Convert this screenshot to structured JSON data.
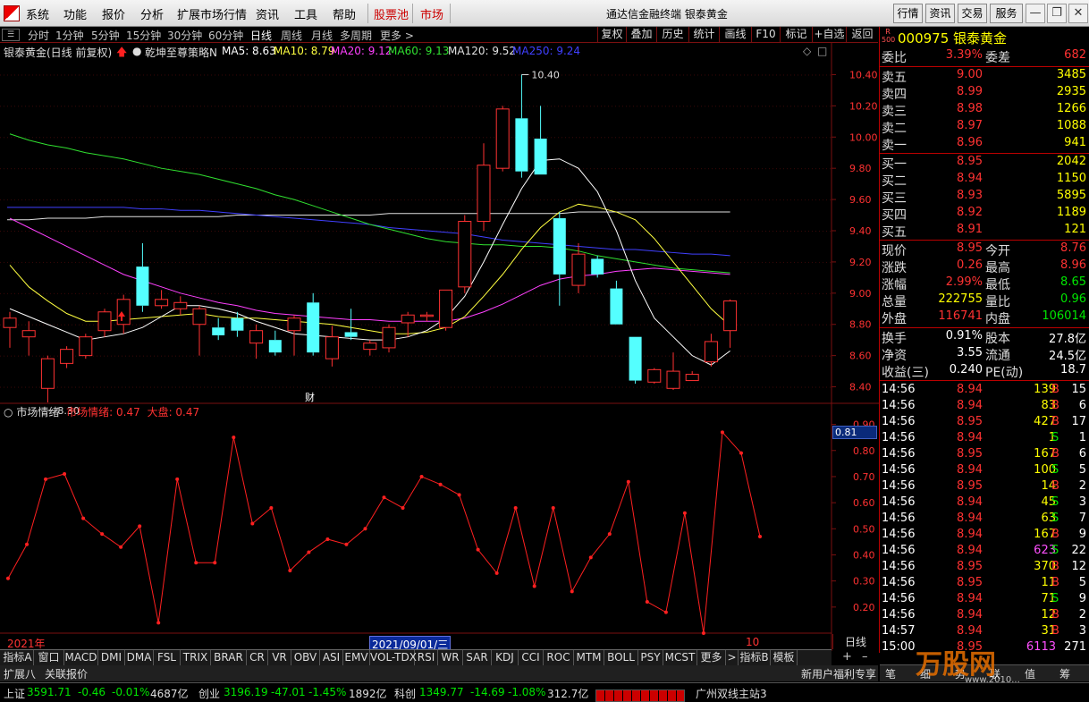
{
  "menu": {
    "items": [
      "系统",
      "功能",
      "报价",
      "分析",
      "扩展市场行情",
      "资讯",
      "工具",
      "帮助"
    ],
    "stock_pool": "股票池",
    "market": "市场",
    "title": "通达信金融终端 银泰黄金",
    "right_buttons": [
      "行情",
      "资讯",
      "交易",
      "服务"
    ]
  },
  "period_bar": {
    "periods": [
      "分时",
      "1分钟",
      "5分钟",
      "15分钟",
      "30分钟",
      "60分钟",
      "日线",
      "周线",
      "月线",
      "多周期",
      "更多 >"
    ],
    "active": "日线",
    "tools": [
      "复权",
      "叠加",
      "历史",
      "统计",
      "画线",
      "F10",
      "标记",
      "+自选",
      "返回"
    ]
  },
  "ma_bar": {
    "name": "银泰黄金(日线 前复权)",
    "strategy": "乾坤至尊策略N",
    "items": [
      {
        "label": "MA5: 8.63",
        "color": "#ffffff"
      },
      {
        "label": "MA10: 8.79",
        "color": "#ffff40"
      },
      {
        "label": "MA20: 9.12",
        "color": "#ff40ff"
      },
      {
        "label": "MA60: 9.13",
        "color": "#30e030"
      },
      {
        "label": "MA120: 9.52",
        "color": "#e0e0e0"
      },
      {
        "label": "MA250: 9.24",
        "color": "#4040ff"
      }
    ]
  },
  "indicator": {
    "name": "市场情绪",
    "value_label": "市场情绪: 0.47",
    "market_label": "大盘: 0.47",
    "current": "0.81"
  },
  "colors": {
    "up": "#ff3232",
    "down": "#54ffff",
    "grid": "#7a1010"
  },
  "chart_data": [
    {
      "type": "candlestick",
      "title": "银泰黄金(日线 前复权)",
      "ylim": [
        8.3,
        10.5
      ],
      "y_ticks": [
        "10.40",
        "10.20",
        "10.00",
        "9.80",
        "9.60",
        "9.40",
        "9.20",
        "9.00",
        "8.80",
        "8.60",
        "8.40"
      ],
      "high_label": "10.40",
      "low_label": "8.30",
      "event_label": "财",
      "ohlc": [
        [
          8.78,
          8.84,
          8.65,
          8.88
        ],
        [
          8.72,
          8.76,
          8.6,
          8.82
        ],
        [
          8.39,
          8.58,
          8.3,
          8.6
        ],
        [
          8.55,
          8.64,
          8.52,
          8.66
        ],
        [
          8.6,
          8.72,
          8.58,
          8.74
        ],
        [
          8.76,
          8.88,
          8.72,
          8.9
        ],
        [
          8.8,
          8.96,
          8.74,
          8.99
        ],
        [
          9.17,
          8.92,
          8.88,
          9.32
        ],
        [
          8.92,
          8.96,
          8.9,
          9.02
        ],
        [
          8.9,
          8.94,
          8.86,
          8.98
        ],
        [
          8.8,
          8.9,
          8.6,
          8.92
        ],
        [
          8.78,
          8.73,
          8.7,
          8.84
        ],
        [
          8.84,
          8.76,
          8.72,
          8.88
        ],
        [
          8.68,
          8.76,
          8.58,
          8.8
        ],
        [
          8.7,
          8.62,
          8.6,
          8.76
        ],
        [
          8.76,
          8.84,
          8.6,
          8.86
        ],
        [
          8.94,
          8.62,
          8.6,
          9.0
        ],
        [
          8.58,
          8.72,
          8.53,
          8.79
        ],
        [
          8.75,
          8.72,
          8.7,
          8.9
        ],
        [
          8.64,
          8.68,
          8.6,
          8.7
        ],
        [
          8.65,
          8.78,
          8.62,
          8.8
        ],
        [
          8.81,
          8.86,
          8.72,
          8.88
        ],
        [
          8.86,
          8.86,
          8.82,
          8.88
        ],
        [
          8.78,
          9.02,
          8.76,
          9.02
        ],
        [
          9.04,
          9.46,
          9.0,
          9.5
        ],
        [
          9.46,
          9.82,
          9.4,
          9.96
        ],
        [
          9.8,
          10.18,
          9.78,
          10.2
        ],
        [
          10.12,
          9.78,
          9.74,
          10.4
        ],
        [
          9.99,
          9.76,
          9.76,
          10.2
        ],
        [
          9.48,
          9.12,
          8.92,
          9.52
        ],
        [
          9.05,
          9.25,
          9.0,
          9.32
        ],
        [
          9.22,
          9.12,
          9.1,
          9.24
        ],
        [
          9.03,
          8.8,
          8.8,
          9.08
        ],
        [
          8.72,
          8.44,
          8.42,
          8.72
        ],
        [
          8.43,
          8.51,
          8.42,
          8.52
        ],
        [
          8.39,
          8.5,
          8.38,
          8.62
        ],
        [
          8.44,
          8.48,
          8.44,
          8.5
        ],
        [
          8.56,
          8.69,
          8.53,
          8.74
        ],
        [
          8.76,
          8.95,
          8.65,
          8.96
        ]
      ],
      "series": [
        {
          "name": "MA5",
          "values": [
            8.9,
            8.85,
            8.8,
            8.75,
            8.7,
            8.72,
            8.74,
            8.78,
            8.85,
            8.92,
            8.92,
            8.9,
            8.87,
            8.82,
            8.78,
            8.74,
            8.73,
            8.72,
            8.71,
            8.7,
            8.7,
            8.72,
            8.76,
            8.84,
            8.98,
            9.2,
            9.44,
            9.67,
            9.85,
            9.86,
            9.8,
            9.65,
            9.4,
            9.08,
            8.84,
            8.72,
            8.6,
            8.54,
            8.63
          ]
        },
        {
          "name": "MA10",
          "values": [
            9.18,
            9.04,
            8.95,
            8.87,
            8.82,
            8.82,
            8.83,
            8.84,
            8.85,
            8.86,
            8.87,
            8.85,
            8.84,
            8.84,
            8.83,
            8.82,
            8.81,
            8.8,
            8.78,
            8.76,
            8.74,
            8.74,
            8.75,
            8.78,
            8.85,
            8.98,
            9.12,
            9.28,
            9.42,
            9.52,
            9.57,
            9.55,
            9.52,
            9.47,
            9.35,
            9.2,
            9.05,
            8.9,
            8.79
          ]
        },
        {
          "name": "MA20",
          "values": [
            9.48,
            9.42,
            9.36,
            9.3,
            9.24,
            9.18,
            9.12,
            9.08,
            9.04,
            9.0,
            8.97,
            8.94,
            8.92,
            8.89,
            8.87,
            8.86,
            8.85,
            8.84,
            8.83,
            8.83,
            8.82,
            8.82,
            8.82,
            8.82,
            8.84,
            8.88,
            8.93,
            8.99,
            9.05,
            9.09,
            9.11,
            9.12,
            9.14,
            9.15,
            9.16,
            9.15,
            9.14,
            9.13,
            9.12
          ]
        },
        {
          "name": "MA60",
          "values": [
            10.02,
            9.98,
            9.95,
            9.93,
            9.9,
            9.88,
            9.86,
            9.83,
            9.8,
            9.78,
            9.76,
            9.73,
            9.7,
            9.67,
            9.63,
            9.6,
            9.56,
            9.52,
            9.48,
            9.44,
            9.41,
            9.38,
            9.35,
            9.33,
            9.32,
            9.31,
            9.31,
            9.3,
            9.3,
            9.29,
            9.27,
            9.24,
            9.22,
            9.2,
            9.18,
            9.16,
            9.15,
            9.14,
            9.13
          ]
        },
        {
          "name": "MA120",
          "values": [
            9.47,
            9.47,
            9.48,
            9.48,
            9.48,
            9.49,
            9.49,
            9.49,
            9.49,
            9.49,
            9.49,
            9.49,
            9.5,
            9.5,
            9.5,
            9.5,
            9.5,
            9.5,
            9.5,
            9.5,
            9.51,
            9.51,
            9.51,
            9.51,
            9.51,
            9.51,
            9.51,
            9.51,
            9.51,
            9.51,
            9.52,
            9.52,
            9.52,
            9.52,
            9.52,
            9.52,
            9.52,
            9.52,
            9.52
          ]
        },
        {
          "name": "MA250",
          "values": [
            9.55,
            9.55,
            9.55,
            9.55,
            9.55,
            9.55,
            9.55,
            9.54,
            9.54,
            9.53,
            9.53,
            9.52,
            9.51,
            9.5,
            9.49,
            9.48,
            9.47,
            9.46,
            9.45,
            9.44,
            9.42,
            9.41,
            9.4,
            9.39,
            9.38,
            9.36,
            9.34,
            9.33,
            9.32,
            9.31,
            9.3,
            9.29,
            9.28,
            9.28,
            9.27,
            9.26,
            9.25,
            9.25,
            9.24
          ]
        }
      ]
    },
    {
      "type": "line",
      "title": "市场情绪",
      "ylim": [
        0.1,
        0.95
      ],
      "y_ticks": [
        "0.90",
        "0.80",
        "0.70",
        "0.60",
        "0.50",
        "0.40",
        "0.30",
        "0.20"
      ],
      "series": [
        {
          "name": "市场情绪",
          "values": [
            0.31,
            0.44,
            0.69,
            0.71,
            0.54,
            0.48,
            0.43,
            0.51,
            0.14,
            0.69,
            0.37,
            0.37,
            0.85,
            0.52,
            0.58,
            0.34,
            0.41,
            0.46,
            0.44,
            0.5,
            0.62,
            0.58,
            0.7,
            0.67,
            0.63,
            0.42,
            0.33,
            0.58,
            0.28,
            0.58,
            0.26,
            0.39,
            0.48,
            0.68,
            0.22,
            0.18,
            0.56,
            0.1,
            0.87,
            0.79,
            0.47
          ]
        }
      ]
    }
  ],
  "x_axis": {
    "year": "2021年",
    "cursor_date": "2021/09/01/三",
    "end_label": "10",
    "period": "日线"
  },
  "indicator_tabs": [
    "指标A",
    "窗口",
    "MACD",
    "DMI",
    "DMA",
    "FSL",
    "TRIX",
    "BRAR",
    "CR",
    "VR",
    "OBV",
    "ASI",
    "EMV",
    "VOL-TDX",
    "RSI",
    "WR",
    "SAR",
    "KDJ",
    "CCI",
    "ROC",
    "MTM",
    "BOLL",
    "PSY",
    "MCST",
    "更多",
    ">",
    "指标B",
    "模板"
  ],
  "ext_tabs": [
    "扩展八",
    "关联报价"
  ],
  "welfare": "新用户福利专享",
  "quote": {
    "badge_top": "R",
    "badge_bottom": "500",
    "code_name": "000975 银泰黄金",
    "weibi": {
      "l": "委比",
      "v": "3.39%",
      "l2": "委差",
      "v2": "682"
    },
    "sell": [
      {
        "l": "卖五",
        "p": "9.00",
        "v": "3485"
      },
      {
        "l": "卖四",
        "p": "8.99",
        "v": "2935"
      },
      {
        "l": "卖三",
        "p": "8.98",
        "v": "1266"
      },
      {
        "l": "卖二",
        "p": "8.97",
        "v": "1088"
      },
      {
        "l": "卖一",
        "p": "8.96",
        "v": "941"
      }
    ],
    "buy": [
      {
        "l": "买一",
        "p": "8.95",
        "v": "2042"
      },
      {
        "l": "买二",
        "p": "8.94",
        "v": "1150"
      },
      {
        "l": "买三",
        "p": "8.93",
        "v": "5895"
      },
      {
        "l": "买四",
        "p": "8.92",
        "v": "1189"
      },
      {
        "l": "买五",
        "p": "8.91",
        "v": "121"
      }
    ],
    "stats": [
      {
        "l": "现价",
        "v": "8.95",
        "c": "red",
        "l2": "今开",
        "v2": "8.76",
        "c2": "red"
      },
      {
        "l": "涨跌",
        "v": "0.26",
        "c": "red",
        "l2": "最高",
        "v2": "8.96",
        "c2": "red"
      },
      {
        "l": "涨幅",
        "v": "2.99%",
        "c": "red",
        "l2": "最低",
        "v2": "8.65",
        "c2": "grn"
      },
      {
        "l": "总量",
        "v": "222755",
        "c": "yel",
        "l2": "量比",
        "v2": "0.96",
        "c2": "grn"
      },
      {
        "l": "外盘",
        "v": "116741",
        "c": "red",
        "l2": "内盘",
        "v2": "106014",
        "c2": "grn"
      }
    ],
    "stats2": [
      {
        "l": "换手",
        "v": "0.91%",
        "l2": "股本",
        "v2": "27.8亿"
      },
      {
        "l": "净资",
        "v": "3.55",
        "l2": "流通",
        "v2": "24.5亿"
      },
      {
        "l": "收益(三)",
        "v": "0.240",
        "l2": "PE(动)",
        "v2": "18.7"
      }
    ],
    "ticks": [
      {
        "t": "14:56",
        "p": "8.94",
        "pc": "red",
        "v": "139",
        "vc": "yel",
        "s": "B",
        "n": "15"
      },
      {
        "t": "14:56",
        "p": "8.94",
        "pc": "red",
        "v": "83",
        "vc": "yel",
        "s": "B",
        "n": "6"
      },
      {
        "t": "14:56",
        "p": "8.95",
        "pc": "red",
        "v": "427",
        "vc": "yel",
        "s": "B",
        "n": "17"
      },
      {
        "t": "14:56",
        "p": "8.94",
        "pc": "red",
        "v": "1",
        "vc": "yel",
        "s": "S",
        "n": "1"
      },
      {
        "t": "14:56",
        "p": "8.95",
        "pc": "red",
        "v": "167",
        "vc": "yel",
        "s": "B",
        "n": "6"
      },
      {
        "t": "14:56",
        "p": "8.94",
        "pc": "red",
        "v": "100",
        "vc": "yel",
        "s": "S",
        "n": "5"
      },
      {
        "t": "14:56",
        "p": "8.95",
        "pc": "red",
        "v": "14",
        "vc": "yel",
        "s": "B",
        "n": "2"
      },
      {
        "t": "14:56",
        "p": "8.94",
        "pc": "red",
        "v": "45",
        "vc": "yel",
        "s": "S",
        "n": "3"
      },
      {
        "t": "14:56",
        "p": "8.94",
        "pc": "red",
        "v": "63",
        "vc": "yel",
        "s": "S",
        "n": "7"
      },
      {
        "t": "14:56",
        "p": "8.94",
        "pc": "red",
        "v": "167",
        "vc": "yel",
        "s": "B",
        "n": "9"
      },
      {
        "t": "14:56",
        "p": "8.94",
        "pc": "red",
        "v": "623",
        "vc": "mag",
        "s": "S",
        "n": "22"
      },
      {
        "t": "14:56",
        "p": "8.95",
        "pc": "red",
        "v": "370",
        "vc": "yel",
        "s": "B",
        "n": "12"
      },
      {
        "t": "14:56",
        "p": "8.95",
        "pc": "red",
        "v": "11",
        "vc": "yel",
        "s": "B",
        "n": "5"
      },
      {
        "t": "14:56",
        "p": "8.94",
        "pc": "red",
        "v": "71",
        "vc": "yel",
        "s": "S",
        "n": "9"
      },
      {
        "t": "14:56",
        "p": "8.94",
        "pc": "red",
        "v": "12",
        "vc": "yel",
        "s": "B",
        "n": "2"
      },
      {
        "t": "14:57",
        "p": "8.94",
        "pc": "red",
        "v": "31",
        "vc": "yel",
        "s": "B",
        "n": "3"
      },
      {
        "t": "15:00",
        "p": "8.95",
        "pc": "red",
        "v": "6113",
        "vc": "mag",
        "s": "",
        "n": "271"
      }
    ]
  },
  "bottom_tabs": [
    "笔",
    "细",
    "势",
    "联",
    "值",
    "筹"
  ],
  "watermark": {
    "text": "万股网",
    "url": "www.2010..."
  },
  "status": {
    "sh": {
      "name": "上证",
      "v": "3591.71",
      "c": "-0.46",
      "p": "-0.01%",
      "a": "4687亿"
    },
    "cy": {
      "name": "创业",
      "v": "3196.19",
      "c": "-47.01",
      "p": "-1.45%",
      "a": "1892亿"
    },
    "kc": {
      "name": "科创",
      "v": "1349.77",
      "c": "-14.69",
      "p": "-1.08%",
      "a": "312.7亿"
    },
    "server": "广州双线主站3"
  }
}
